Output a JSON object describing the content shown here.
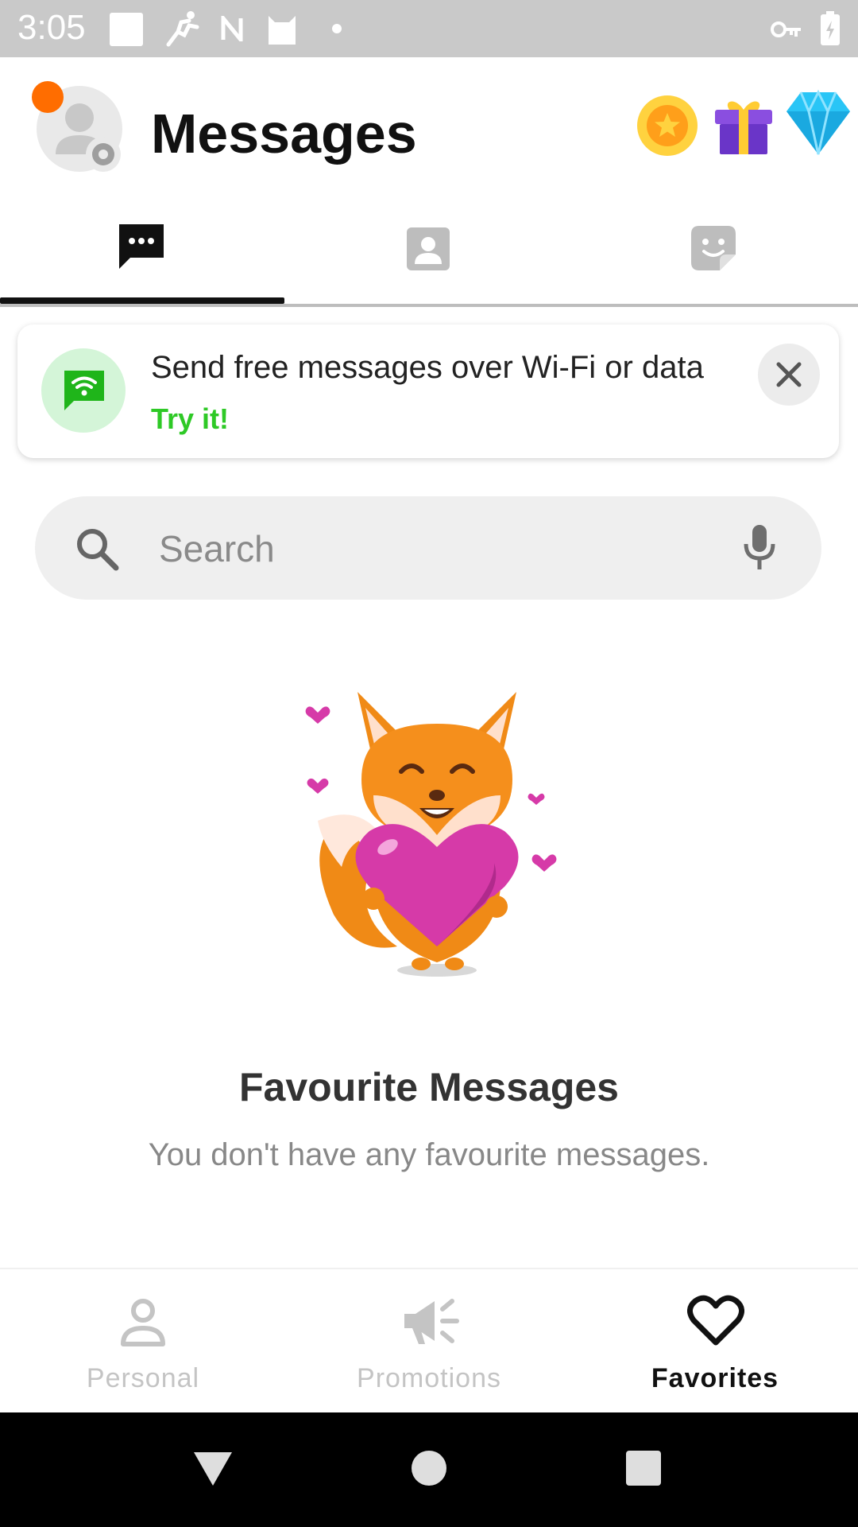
{
  "status_bar": {
    "time": "3:05",
    "icons": [
      "square-icon",
      "runner-icon",
      "n-icon",
      "cat-icon",
      "dot-icon",
      "key-icon",
      "battery-icon"
    ]
  },
  "header": {
    "title": "Messages",
    "avatar": "profile-avatar-with-settings",
    "notification_color": "#ff6d00",
    "right_icons": [
      "coin-icon",
      "gift-icon",
      "diamond-icon"
    ]
  },
  "tabs": {
    "items": [
      {
        "name": "chats",
        "icon": "chat-bubble-icon",
        "active": true
      },
      {
        "name": "contacts",
        "icon": "contact-card-icon",
        "active": false
      },
      {
        "name": "stickers",
        "icon": "sticker-icon",
        "active": false
      }
    ]
  },
  "promo": {
    "text": "Send free messages over Wi-Fi or data",
    "link_label": "Try it!",
    "accent_color": "#2ec926"
  },
  "search": {
    "placeholder": "Search",
    "value": ""
  },
  "empty_state": {
    "title": "Favourite Messages",
    "subtitle": "You don't have any favourite messages.",
    "illustration": "fox-holding-heart"
  },
  "bottom_nav": {
    "items": [
      {
        "label": "Personal",
        "icon": "person-icon",
        "active": false
      },
      {
        "label": "Promotions",
        "icon": "megaphone-icon",
        "active": false
      },
      {
        "label": "Favorites",
        "icon": "heart-icon",
        "active": true
      }
    ]
  },
  "system_nav": [
    "back-button",
    "home-button",
    "recents-button"
  ]
}
